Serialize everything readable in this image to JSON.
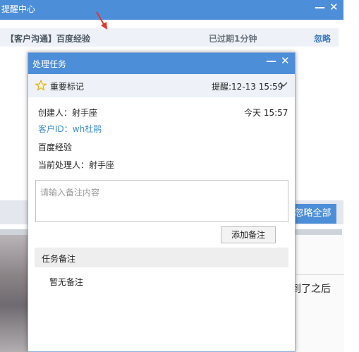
{
  "background_window": {
    "title": "提醒中心",
    "minimize_glyph": "—",
    "close_glyph": "✕",
    "reminder": {
      "title": "【客户沟通】百度经验",
      "status": "已过期1分钟",
      "action": "忽略"
    },
    "ignore_all_label": "忽略全部",
    "partial_text": "到了之后",
    "colors": {
      "titlebar": "#4d8ed9",
      "link": "#3a78c0",
      "arrow": "#e0352b"
    }
  },
  "dialog": {
    "title": "处理任务",
    "minimize_glyph": "—",
    "close_glyph": "✕",
    "important_label": "重要标记",
    "remind_label": "提醒:12-13 15:59",
    "creator": "创建人：射手座",
    "created_time": "今天 15:57",
    "customer_id": "客户ID：wh杜鹃",
    "task_title": "百度经验",
    "handler": "当前处理人：射手座",
    "note_placeholder": "请输入备注内容",
    "note_value": "",
    "add_note_label": "添加备注",
    "notes_header": "任务备注",
    "no_notes": "暂无备注",
    "icons": {
      "star": "star-icon",
      "expand": "chevron-down-icon"
    }
  }
}
